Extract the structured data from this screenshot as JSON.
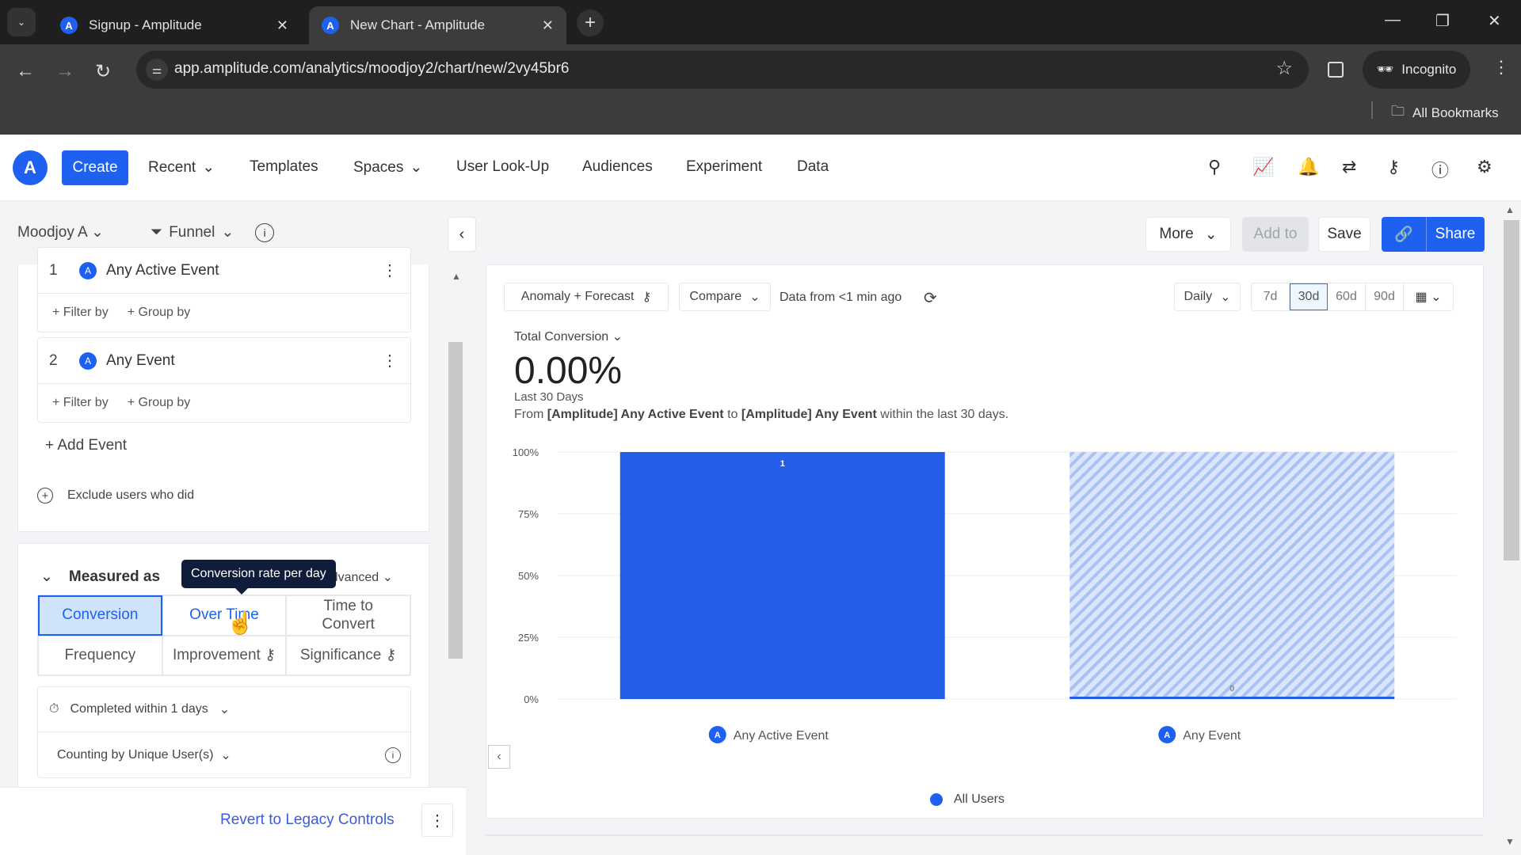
{
  "browser": {
    "tabs": [
      {
        "title": "Signup - Amplitude",
        "active": false
      },
      {
        "title": "New Chart - Amplitude",
        "active": true
      }
    ],
    "url": "app.amplitude.com/analytics/moodjoy2/chart/new/2vy45br6",
    "profile": "Incognito",
    "bookmarks": "All Bookmarks"
  },
  "nav": {
    "create": "Create",
    "items": [
      "Recent",
      "Templates",
      "Spaces",
      "User Look-Up",
      "Audiences",
      "Experiment",
      "Data"
    ],
    "icons": [
      "search-icon",
      "notebook-icon",
      "bell-icon",
      "swap-icon",
      "key-icon",
      "help-icon",
      "gear-icon"
    ]
  },
  "subheader": {
    "project": "Moodjoy A",
    "chart_type": "Funnel",
    "more": "More",
    "add_to": "Add to",
    "save": "Save",
    "share": "Share"
  },
  "events": [
    {
      "num": "1",
      "name": "Any Active Event",
      "filter": "+ Filter by",
      "group": "+ Group by"
    },
    {
      "num": "2",
      "name": "Any Event",
      "filter": "+ Filter by",
      "group": "+ Group by"
    }
  ],
  "add_event": "+ Add Event",
  "exclude": "Exclude users who did",
  "measured": {
    "title": "Measured as",
    "advanced": "Advanced",
    "tooltip": "Conversion rate per day",
    "options": [
      "Conversion",
      "Over Time",
      "Time to\nConvert",
      "Frequency",
      "Improvement",
      "Significance"
    ],
    "selected": "Conversion",
    "completed_within": "Completed within 1 days",
    "counting": "Counting by Unique User(s)"
  },
  "revert": "Revert to Legacy Controls",
  "chart_controls": {
    "anomaly": "Anomaly + Forecast",
    "compare": "Compare",
    "data_from": "Data from <1 min ago",
    "interval": "Daily",
    "ranges": [
      "7d",
      "30d",
      "60d",
      "90d"
    ],
    "selected_range": "30d"
  },
  "summary": {
    "metric_label": "Total Conversion",
    "value": "0.00%",
    "period": "Last 30 Days",
    "desc_from": "From ",
    "desc_e1": "[Amplitude] Any Active Event",
    "desc_to": " to ",
    "desc_e2": "[Amplitude] Any Event",
    "desc_end": " within the last 30 days."
  },
  "colors": {
    "accent": "#1e61f0",
    "bar": "#235ee8",
    "bar_hatch": "#c6d8f7"
  },
  "chart_data": {
    "type": "bar",
    "categories": [
      "Any Active Event",
      "Any Event"
    ],
    "series": [
      {
        "name": "All Users",
        "values": [
          100,
          0
        ],
        "labels": [
          "1",
          "0"
        ]
      }
    ],
    "ylabel": "",
    "xlabel": "",
    "yticks": [
      "0%",
      "25%",
      "50%",
      "75%",
      "100%"
    ],
    "ylim": [
      0,
      100
    ],
    "legend": "bottom-center",
    "grid": true
  }
}
